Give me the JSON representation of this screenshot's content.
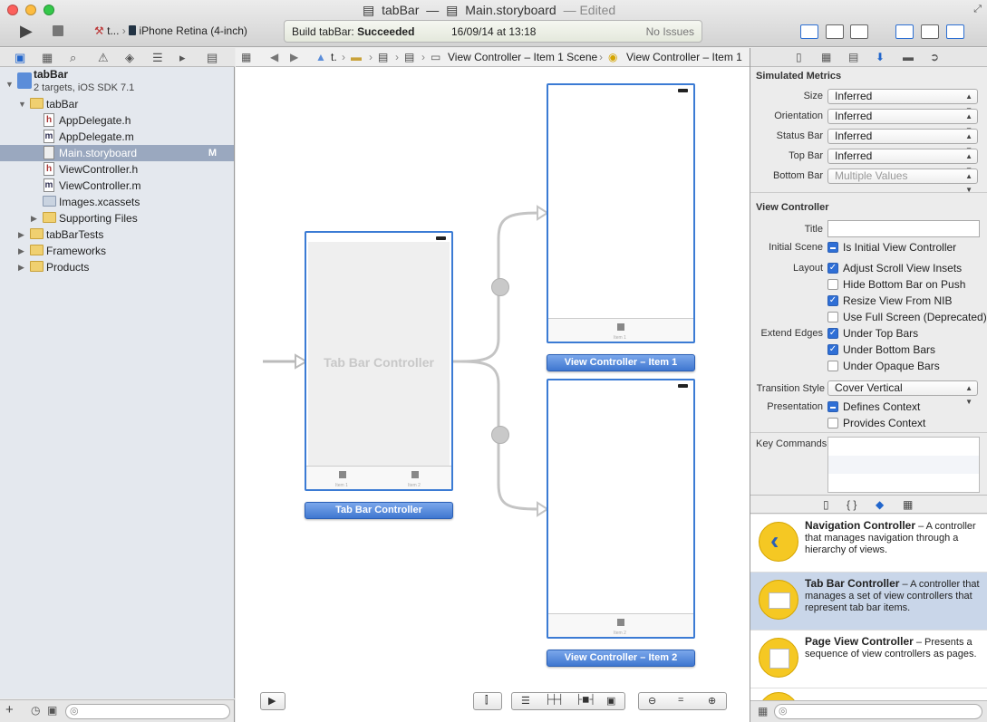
{
  "window": {
    "project": "tabBar",
    "separator": "—",
    "file": "Main.storyboard",
    "edited": "— Edited"
  },
  "toolbar": {
    "run_icon": "play-icon",
    "stop_icon": "stop-icon",
    "scheme_target": "t...",
    "scheme_device": "iPhone Retina (4-inch)"
  },
  "activity": {
    "message_prefix": "Build tabBar:",
    "message_status": "Succeeded",
    "date": "16/09/14 at 13:18",
    "issues": "No Issues",
    "accent": "#e4e8dc"
  },
  "navigator": {
    "project_name": "tabBar",
    "project_sub": "2 targets, iOS SDK 7.1",
    "items": [
      {
        "label": "tabBar",
        "kind": "folder"
      },
      {
        "label": "AppDelegate.h",
        "kind": "h"
      },
      {
        "label": "AppDelegate.m",
        "kind": "m"
      },
      {
        "label": "Main.storyboard",
        "kind": "storyboard",
        "badge": "M"
      },
      {
        "label": "ViewController.h",
        "kind": "h"
      },
      {
        "label": "ViewController.m",
        "kind": "m"
      },
      {
        "label": "Images.xcassets",
        "kind": "assets"
      },
      {
        "label": "Supporting Files",
        "kind": "folder"
      },
      {
        "label": "tabBarTests",
        "kind": "folder"
      },
      {
        "label": "Frameworks",
        "kind": "folder"
      },
      {
        "label": "Products",
        "kind": "folder"
      }
    ]
  },
  "jumpbar": {
    "crumb1": "t.",
    "crumb2": "View Controller – Item 1 Scene",
    "crumb3": "View Controller – Item 1"
  },
  "canvas": {
    "tab_bar_controller_text": "Tab Bar Controller",
    "tab_bar_controller_label": "Tab Bar Controller",
    "vc1_label": "View Controller – Item 1",
    "vc2_label": "View Controller – Item 2",
    "item1": "Item 1",
    "item2": "Item 2"
  },
  "inspector": {
    "simulated_metrics": "Simulated Metrics",
    "size_label": "Size",
    "size_value": "Inferred",
    "orientation_label": "Orientation",
    "orientation_value": "Inferred",
    "status_bar_label": "Status Bar",
    "status_bar_value": "Inferred",
    "top_bar_label": "Top Bar",
    "top_bar_value": "Inferred",
    "bottom_bar_label": "Bottom Bar",
    "bottom_bar_value": "Multiple Values",
    "view_controller": "View Controller",
    "title_label": "Title",
    "title_value": "",
    "initial_scene_label": "Initial Scene",
    "is_initial": "Is Initial View Controller",
    "layout_label": "Layout",
    "adjust_scroll": "Adjust Scroll View Insets",
    "hide_bottom": "Hide Bottom Bar on Push",
    "resize_nib": "Resize View From NIB",
    "use_full": "Use Full Screen (Deprecated)",
    "extend_label": "Extend Edges",
    "under_top": "Under Top Bars",
    "under_bottom": "Under Bottom Bars",
    "under_opaque": "Under Opaque Bars",
    "transition_label": "Transition Style",
    "transition_value": "Cover Vertical",
    "presentation_label": "Presentation",
    "defines_context": "Defines Context",
    "provides_context": "Provides Context",
    "key_commands_label": "Key Commands"
  },
  "library": {
    "tab_braces": "{ }",
    "items": [
      {
        "title": "Navigation Controller",
        "desc": " – A controller that manages navigation through a hierarchy of views."
      },
      {
        "title": "Tab Bar Controller",
        "desc": " – A controller that manages a set of view controllers that represent tab bar items."
      },
      {
        "title": "Page View Controller",
        "desc": " – Presents a sequence of view controllers as pages."
      }
    ]
  }
}
